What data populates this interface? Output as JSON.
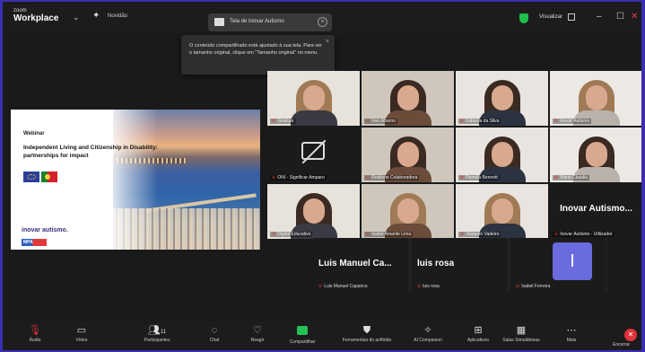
{
  "app": {
    "brand_small": "zoom",
    "brand_big": "Workplace"
  },
  "titlebar": {
    "news_label": "Novidão",
    "share_label": "Tela de Inovar Autismo",
    "view_label": "Visualizar",
    "minimize": "–",
    "maximize": "☐",
    "close": "✕"
  },
  "toast": {
    "message": "O conteúdo compartilhado está ajustado à sua tela. Para ver o tamanho original, clique em \"Tamanho original\" no menu.",
    "close": "×"
  },
  "slide": {
    "webinar": "Webinar",
    "title": "Independent Living and Citizenship in Disability: partnerships for impact",
    "logo_text": "inovar autismo.",
    "logo2_text": "MPA"
  },
  "participants": [
    {
      "name": "Graduar",
      "tone": "light"
    },
    {
      "name": "Ines Abarno",
      "tone": "dark"
    },
    {
      "name": "Fabiana da Silva",
      "tone": "dark"
    },
    {
      "name": "Inovar Autismo",
      "tone": "light"
    },
    {
      "name": "ONI - Significar Amparo",
      "cam_off": true
    },
    {
      "name": "Rosilene Colaboradora",
      "tone": "dark"
    },
    {
      "name": "Pamela Bennett",
      "tone": "dark",
      "active": true
    },
    {
      "name": "Maria Claudia",
      "tone": "dark"
    },
    {
      "name": "Digital Educativo",
      "tone": "dark"
    },
    {
      "name": "Isabel Amante Lima",
      "tone": "light"
    },
    {
      "name": "Joaquim Vadeiro",
      "tone": "light"
    },
    {
      "name": "Inovar Autismo - Utilizador",
      "big": "Inovar Autismo..."
    }
  ],
  "strip": [
    {
      "big": "Luis Manuel Ca...",
      "cap": "Luis Manuel Caparica"
    },
    {
      "big": "luis rosa",
      "cap": "luis rosa"
    },
    {
      "avatar": "I",
      "cap": "Isabel Ferreira"
    }
  ],
  "toolbar": {
    "audio": "Áudio",
    "video": "Vídeo",
    "participants": "Participantes",
    "participants_count": "11",
    "chat": "Chat",
    "react": "Reagir",
    "share": "Compartilhar",
    "notes": "Ferramentas do anfitrião",
    "ai": "AI Companion",
    "apps": "Aplicativos",
    "breakout": "Salas Simultâneas",
    "more": "Mais",
    "end": "Encerrar"
  },
  "colors": {
    "accent_green": "#24c257",
    "mute_red": "#e0323c",
    "avatar": "#6b6be0",
    "frame": "#3b2fb0"
  }
}
